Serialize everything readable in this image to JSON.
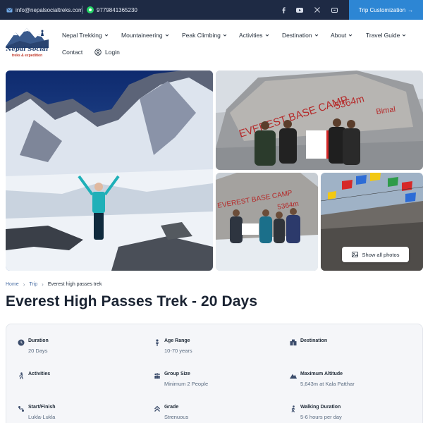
{
  "topbar": {
    "email": "info@nepalsocialtreks.com",
    "phone": "9779841365230",
    "social": [
      "facebook-icon",
      "youtube-icon",
      "x-icon",
      "message-icon"
    ],
    "cta_label": "Trip Customization",
    "cta_arrow": "→"
  },
  "logo": {
    "name": "Nepal Social",
    "tagline": "treks & expedition"
  },
  "nav": {
    "items": [
      {
        "label": "Nepal Trekking",
        "dropdown": true
      },
      {
        "label": "Mountaineering",
        "dropdown": true
      },
      {
        "label": "Peak Climbing",
        "dropdown": true
      },
      {
        "label": "Activities",
        "dropdown": true
      },
      {
        "label": "Destination",
        "dropdown": true
      },
      {
        "label": "About",
        "dropdown": true
      },
      {
        "label": "Travel Guide",
        "dropdown": true
      },
      {
        "label": "Contact",
        "dropdown": false
      }
    ],
    "login": "Login"
  },
  "gallery": {
    "show_all": "Show all photos",
    "sign_text": "EVEREST BASE CAMP",
    "sign_alt": "5364m",
    "sign_extra": "Bimal"
  },
  "breadcrumb": {
    "home": "Home",
    "trip": "Trip",
    "current": "Everest high passes trek"
  },
  "title": "Everest High Passes Trek - 20 Days",
  "facts": {
    "duration": {
      "label": "Duration",
      "value": "20 Days",
      "icon": "clock-icon"
    },
    "age": {
      "label": "Age Range",
      "value": "10-70 years",
      "icon": "person-icon"
    },
    "destination": {
      "label": "Destination",
      "value": "",
      "icon": "globe-icon"
    },
    "activities": {
      "label": "Activities",
      "value": "",
      "icon": "hiker-icon"
    },
    "group": {
      "label": "Group Size",
      "value": "Minimum 2 People",
      "icon": "group-icon"
    },
    "altitude": {
      "label": "Maximum Altitude",
      "value": "5,643m at Kala Patthar",
      "icon": "mountain-icon"
    },
    "startfinish": {
      "label": "Start/Finish",
      "value": "Lukla-Lukla",
      "icon": "route-icon"
    },
    "grade": {
      "label": "Grade",
      "value": "Strenuous",
      "icon": "grade-icon"
    },
    "walking": {
      "label": "Walking Duration",
      "value": "5-6 hours per day",
      "icon": "walker-icon"
    }
  },
  "colors": {
    "topbar": "#1e2a44",
    "accent": "#2d86d4",
    "panel": "#f5f6f9"
  }
}
